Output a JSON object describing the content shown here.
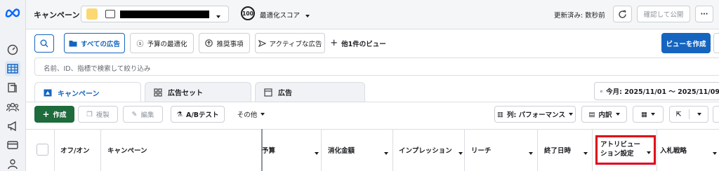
{
  "top": {
    "campaign_label": "キャンペーン",
    "score_value": "100",
    "score_label": "最適化スコア",
    "updated": "更新済み: 数秒前",
    "publish": "確認して公開",
    "more": "···"
  },
  "filters": {
    "items": [
      "すべての広告",
      "予算の最適化",
      "推奨事項",
      "アクティブな広告"
    ],
    "more_views": "他1件のビュー",
    "create_view": "ビューを作成"
  },
  "search": {
    "placeholder": "名前、ID、指標で検索して絞り込み"
  },
  "tabs": [
    "キャンペーン",
    "広告セット",
    "広告"
  ],
  "date_range": "今月: 2025/11/01 〜 2025/11/09",
  "toolbar": {
    "create": "作成",
    "duplicate": "複製",
    "edit": "編集",
    "ab_test": "A/Bテスト",
    "other": "その他",
    "columns": "列: パフォーマンス",
    "breakdown": "内訳"
  },
  "table": {
    "columns": [
      "オフ/オン",
      "キャンペーン",
      "予算",
      "消化金額",
      "インプレッション",
      "リーチ",
      "終了日時",
      "アトリビューション設定",
      "入札戦略"
    ]
  },
  "colors": {
    "accent": "#1565c0",
    "create": "#1e6b3c",
    "highlight": "#e0001b"
  }
}
